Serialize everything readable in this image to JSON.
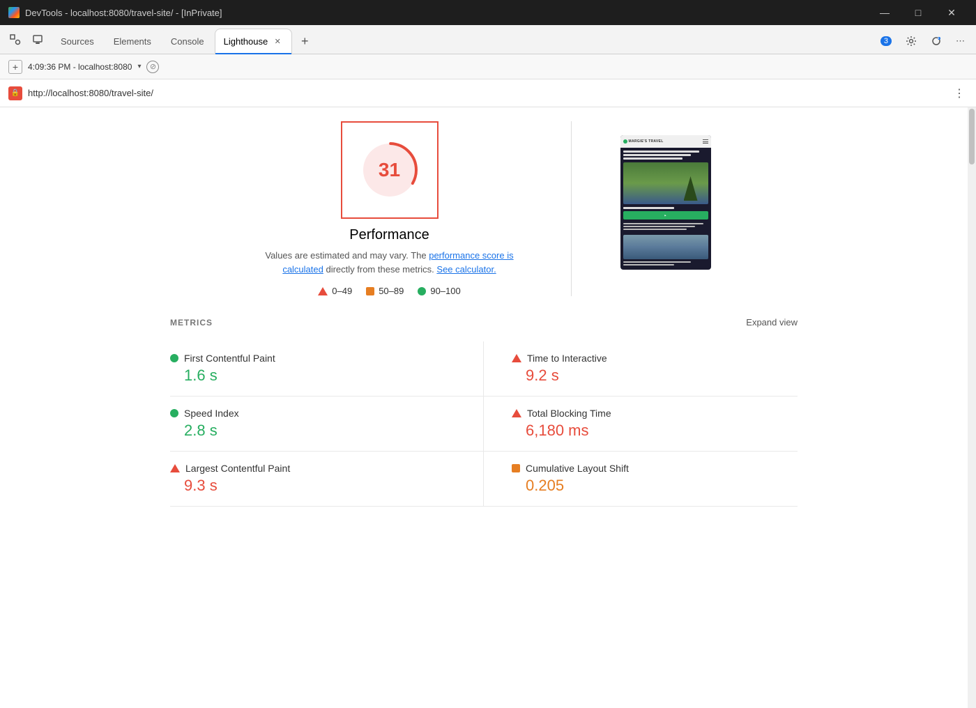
{
  "titlebar": {
    "title": "DevTools - localhost:8080/travel-site/ - [InPrivate]",
    "min_label": "—",
    "max_label": "□",
    "close_label": "✕"
  },
  "tabs": {
    "sources_label": "Sources",
    "elements_label": "Elements",
    "console_label": "Console",
    "lighthouse_label": "Lighthouse",
    "add_label": "+",
    "badge_count": "3"
  },
  "secondary_bar": {
    "time_url": "4:09:36 PM - localhost:8080",
    "stop_label": "⊘"
  },
  "urlbar": {
    "url": "http://localhost:8080/travel-site/",
    "more_label": "⋮"
  },
  "performance": {
    "score": "31",
    "label": "Performance",
    "description_static": "Values are estimated and may vary. The ",
    "link1_text": "performance score is calculated",
    "description_mid": " directly from these metrics. ",
    "link2_text": "See calculator.",
    "legend": [
      {
        "type": "triangle",
        "range": "0–49"
      },
      {
        "type": "square",
        "range": "50–89"
      },
      {
        "type": "circle",
        "range": "90–100"
      }
    ]
  },
  "metrics": {
    "title": "METRICS",
    "expand_label": "Expand view",
    "items": [
      {
        "id": "fcp",
        "name": "First Contentful Paint",
        "value": "1.6 s",
        "indicator": "green",
        "side": "left"
      },
      {
        "id": "tti",
        "name": "Time to Interactive",
        "value": "9.2 s",
        "indicator": "red",
        "side": "right"
      },
      {
        "id": "si",
        "name": "Speed Index",
        "value": "2.8 s",
        "indicator": "green",
        "side": "left"
      },
      {
        "id": "tbt",
        "name": "Total Blocking Time",
        "value": "6,180 ms",
        "indicator": "red",
        "side": "right"
      },
      {
        "id": "lcp",
        "name": "Largest Contentful Paint",
        "value": "9.3 s",
        "indicator": "red",
        "side": "left"
      },
      {
        "id": "cls",
        "name": "Cumulative Layout Shift",
        "value": "0.205",
        "indicator": "orange",
        "side": "right"
      }
    ]
  },
  "screenshot": {
    "alt": "Travel site preview",
    "site_name": "MARGIE'S TRAVEL",
    "description_text": "Discover beautiful Corsica, where stunning landscapes and crystal clear waters meet in a unique natural paradise",
    "guide_text": "Our best destination guides for you",
    "bottom_text": "Bolagna's hills and villages"
  }
}
